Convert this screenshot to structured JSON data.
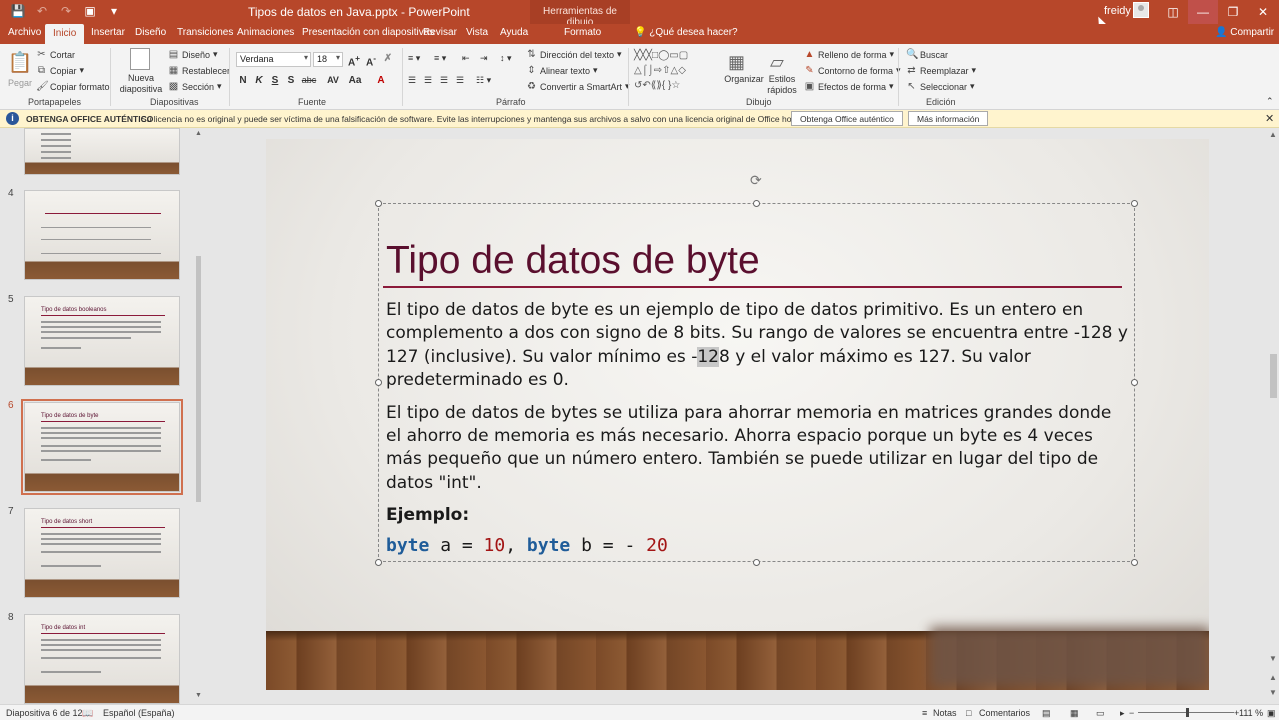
{
  "titlebar": {
    "document_title": "Tipos de datos en Java.pptx  -  PowerPoint",
    "context_tools": "Herramientas de dibujo",
    "user": "freidy"
  },
  "tabs": {
    "items": [
      "Archivo",
      "Inicio",
      "Insertar",
      "Diseño",
      "Transiciones",
      "Animaciones",
      "Presentación con diapositivas",
      "Revisar",
      "Vista",
      "Ayuda",
      "Formato"
    ],
    "active": "Inicio",
    "tell_me": "¿Qué desea hacer?",
    "share": "Compartir"
  },
  "ribbon": {
    "clipboard": {
      "paste": "Pegar",
      "cut": "Cortar",
      "copy": "Copiar",
      "format_painter": "Copiar formato",
      "label": "Portapapeles"
    },
    "slides": {
      "new_slide": "Nueva diapositiva",
      "layout": "Diseño",
      "reset": "Restablecer",
      "section": "Sección",
      "label": "Diapositivas"
    },
    "font": {
      "name": "Verdana",
      "size": "18",
      "bold": "N",
      "italic": "K",
      "underline": "S",
      "shadow": "S",
      "strike": "abc",
      "label": "Fuente"
    },
    "paragraph": {
      "text_direction": "Dirección del texto",
      "align_text": "Alinear texto",
      "smartart": "Convertir a SmartArt",
      "label": "Párrafo"
    },
    "drawing": {
      "arrange": "Organizar",
      "quick_styles": "Estilos rápidos",
      "shape_fill": "Relleno de forma",
      "shape_outline": "Contorno de forma",
      "shape_effects": "Efectos de forma",
      "label": "Dibujo"
    },
    "editing": {
      "find": "Buscar",
      "replace": "Reemplazar",
      "select": "Seleccionar",
      "label": "Edición"
    }
  },
  "warning": {
    "title": "OBTENGA OFFICE AUTÉNTICO",
    "message": "Su licencia no es original y puede ser víctima de una falsificación de software. Evite las interrupciones y mantenga sus archivos a salvo con una licencia original de Office hoy mismo.",
    "button1": "Obtenga Office auténtico",
    "button2": "Más información"
  },
  "thumbnails": [
    {
      "number": "4"
    },
    {
      "number": "5",
      "title": "Tipo de datos booleanos"
    },
    {
      "number": "6",
      "title": "Tipo de datos de byte",
      "selected": true
    },
    {
      "number": "7",
      "title": "Tipo de datos short"
    },
    {
      "number": "8",
      "title": "Tipo de datos int"
    }
  ],
  "slide": {
    "title": "Tipo de datos de byte",
    "para1_a": "El tipo de datos de byte es un ejemplo de tipo de datos primitivo. Es un entero en complemento a dos con signo de 8 bits. Su rango de valores se encuentra entre -128 y 127 (inclusive). Su valor mínimo es -",
    "para1_hl": "12",
    "para1_b": "8 y el valor máximo es 127. Su valor predeterminado es 0.",
    "para2": "El tipo de datos de bytes se utiliza para ahorrar memoria en matrices grandes donde el ahorro de memoria es más necesario. Ahorra espacio porque un byte es 4 veces más pequeño que un número entero. También se puede utilizar en lugar del tipo de datos \"int\".",
    "example_label": "Ejemplo:",
    "code": {
      "kw1": "byte",
      "var1": " a = ",
      "val1": "10",
      "sep": ", ",
      "kw2": "byte",
      "var2": " b = - ",
      "val2": "20"
    }
  },
  "status": {
    "slide_info": "Diapositiva 6 de 12",
    "language": "Español (España)",
    "notes": "Notas",
    "comments": "Comentarios",
    "zoom": "111 %"
  },
  "colors": {
    "accent": "#b7472a",
    "title": "#5a0f2e",
    "keyword": "#1f5c99",
    "number": "#a31515"
  }
}
